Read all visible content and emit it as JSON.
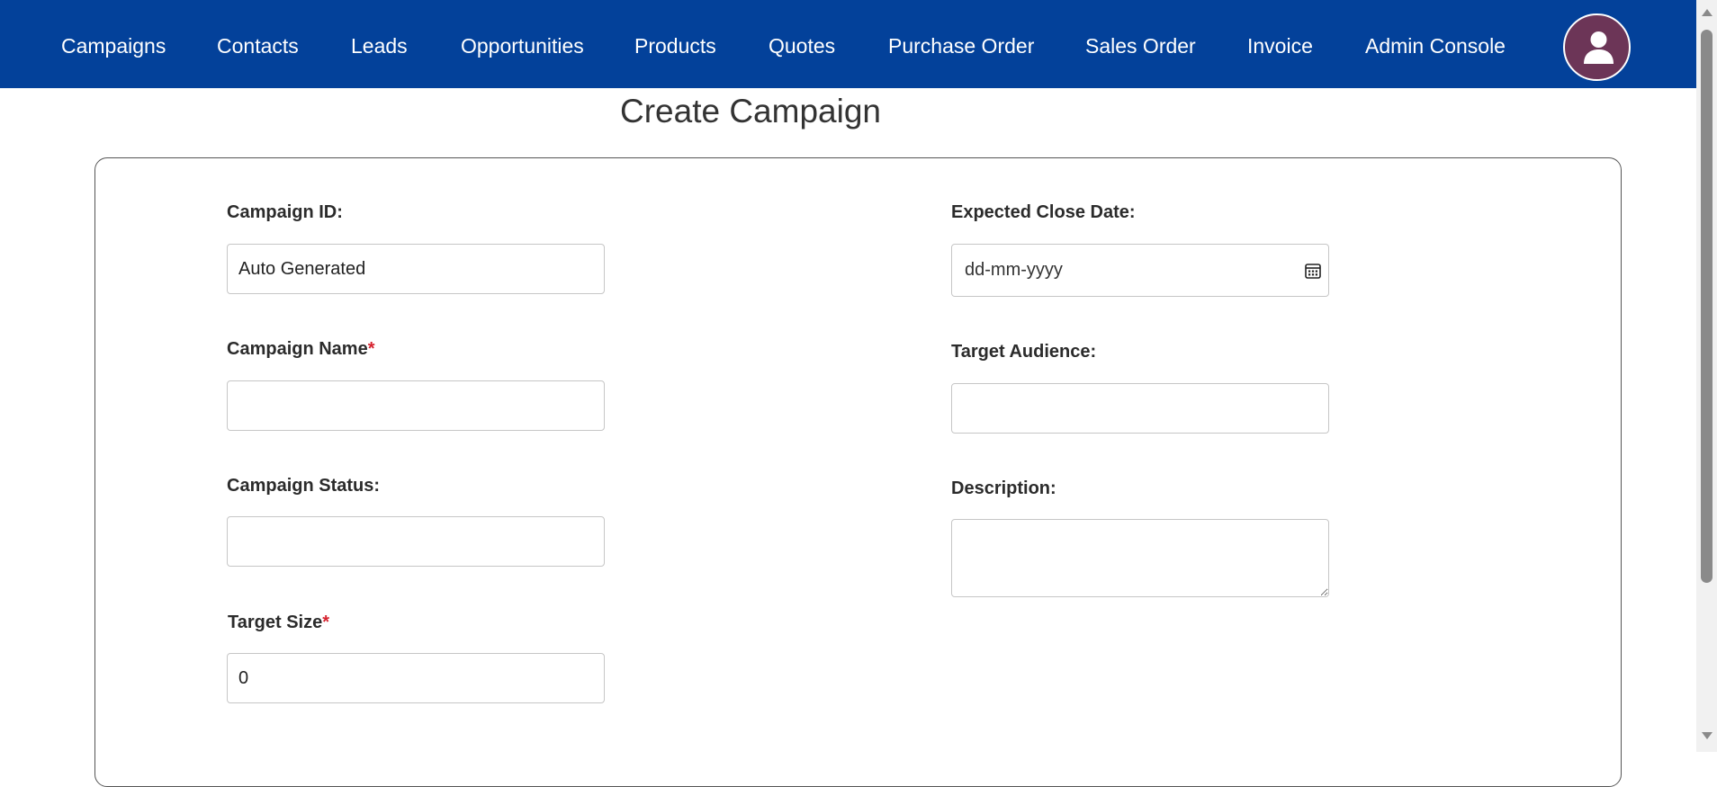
{
  "nav": {
    "items": [
      {
        "label": "Campaigns"
      },
      {
        "label": "Contacts"
      },
      {
        "label": "Leads"
      },
      {
        "label": "Opportunities"
      },
      {
        "label": "Products"
      },
      {
        "label": "Quotes"
      },
      {
        "label": "Purchase Order"
      },
      {
        "label": "Sales Order"
      },
      {
        "label": "Invoice"
      },
      {
        "label": "Admin Console"
      }
    ],
    "avatar_icon": "user-icon"
  },
  "page": {
    "title": "Create Campaign"
  },
  "form": {
    "campaign_id": {
      "label": "Campaign ID:",
      "value": "Auto Generated"
    },
    "campaign_name": {
      "label": "Campaign Name",
      "required_mark": "*",
      "value": ""
    },
    "campaign_status": {
      "label": "Campaign Status:",
      "value": ""
    },
    "target_size": {
      "label": "Target Size",
      "required_mark": "*",
      "value": "0"
    },
    "expected_close_date": {
      "label": "Expected Close Date:",
      "placeholder": "dd-mm-yyyy",
      "icon": "calendar-icon"
    },
    "target_audience": {
      "label": "Target Audience:",
      "value": ""
    },
    "description": {
      "label": "Description:",
      "value": ""
    }
  },
  "colors": {
    "navbar": "#03419a",
    "avatar": "#6c3557",
    "required": "#d6232f"
  }
}
